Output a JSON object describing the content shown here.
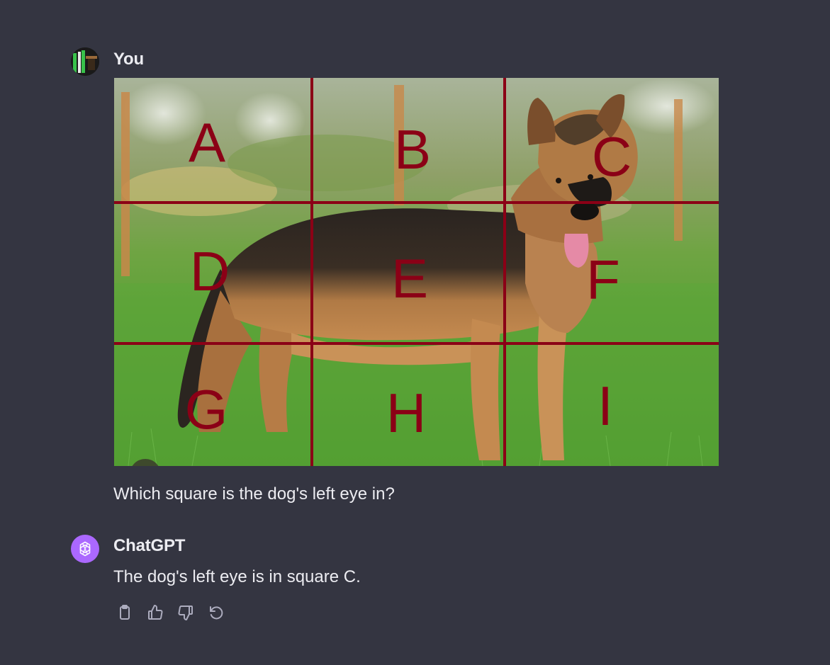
{
  "user_message": {
    "author": "You",
    "text": "Which square is the dog's left eye in?",
    "image": {
      "grid_labels": [
        "A",
        "B",
        "C",
        "D",
        "E",
        "F",
        "G",
        "H",
        "I"
      ],
      "grid_color": "#8b0016"
    }
  },
  "assistant_message": {
    "author": "ChatGPT",
    "text": "The dog's left eye is in square C.",
    "avatar_color": "#ab68ff"
  },
  "actions": [
    {
      "icon": "clipboard-icon"
    },
    {
      "icon": "thumbs-up-icon"
    },
    {
      "icon": "thumbs-down-icon"
    },
    {
      "icon": "regenerate-icon"
    }
  ],
  "colors": {
    "background": "#343541",
    "text": "#ececf1",
    "icon": "#acacbe"
  }
}
